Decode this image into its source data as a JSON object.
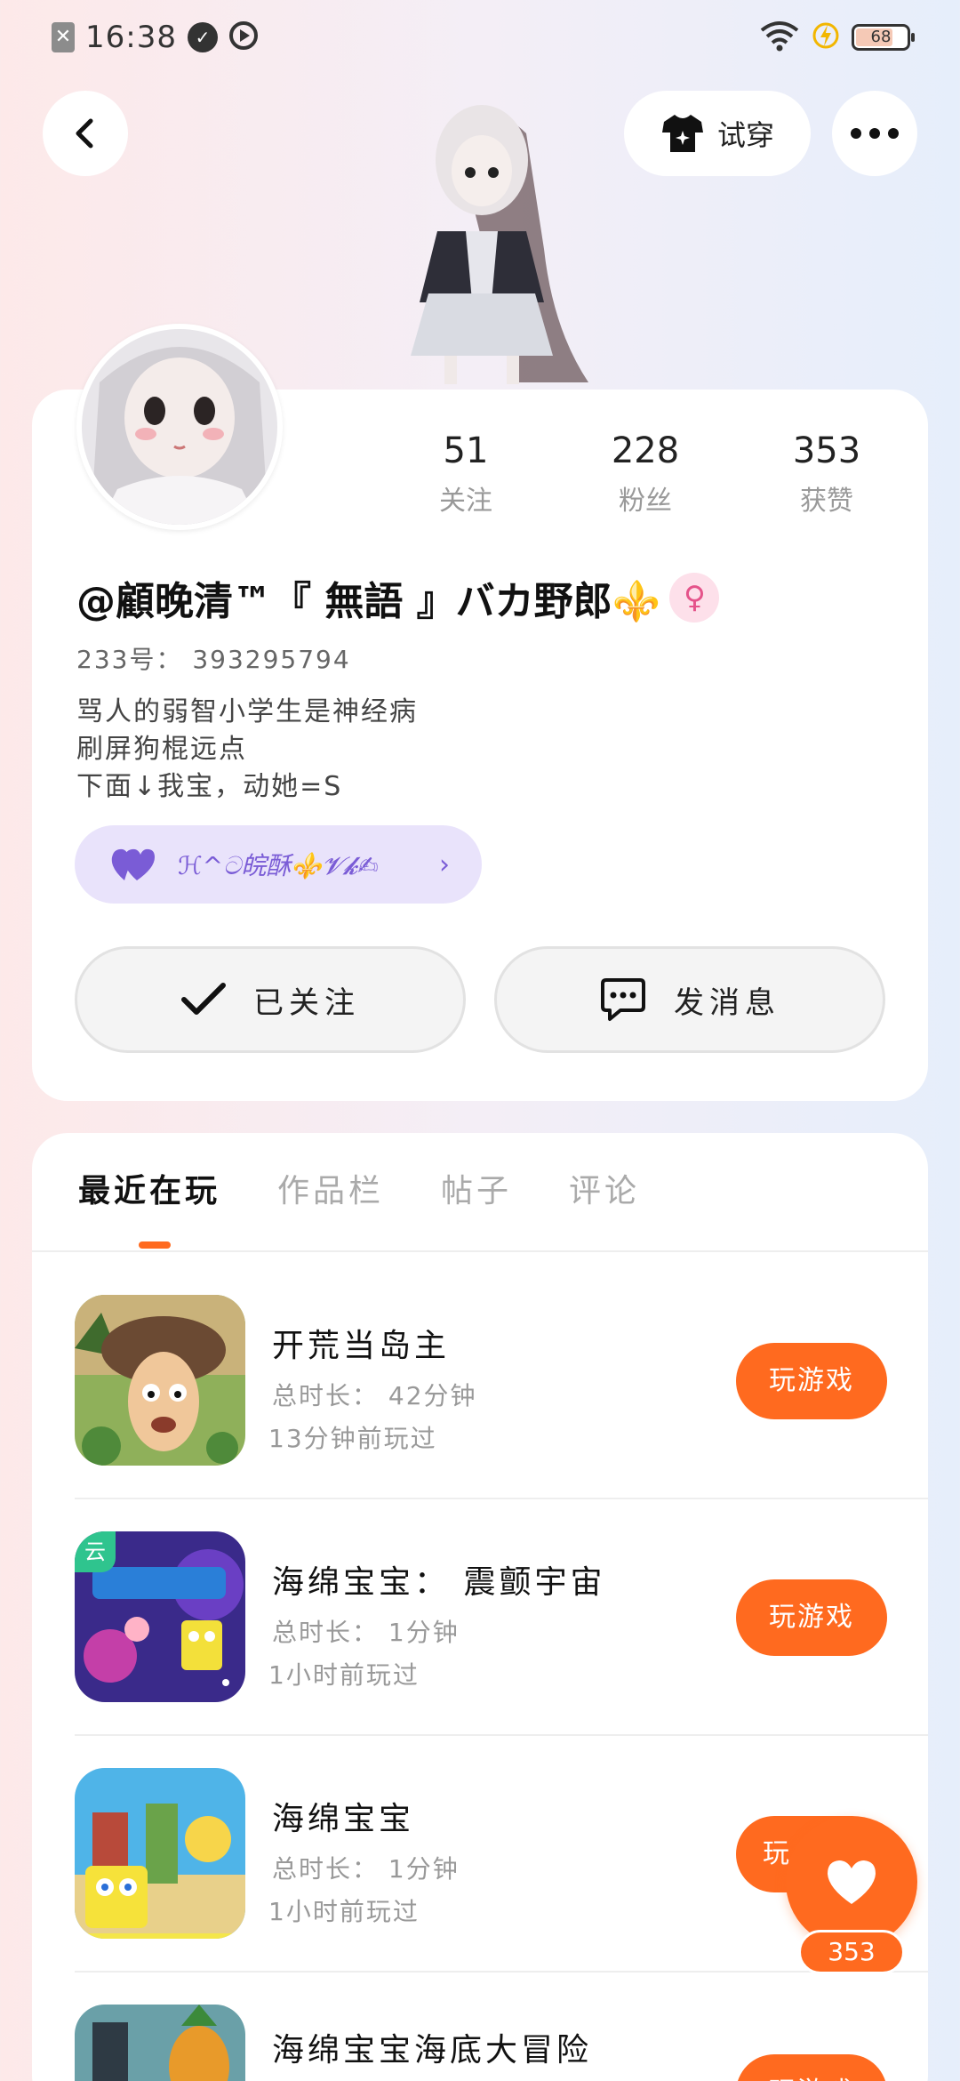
{
  "status_bar": {
    "time": "16:38",
    "battery": "68"
  },
  "header": {
    "try_on_label": "试穿"
  },
  "profile": {
    "stats": [
      {
        "value": "51",
        "label": "关注"
      },
      {
        "value": "228",
        "label": "粉丝"
      },
      {
        "value": "353",
        "label": "获赞"
      }
    ],
    "nickname": "@顧晚清™『 無語 』バカ野郎⚜️",
    "uid": "233号： 393295794",
    "bio": [
      "骂人的弱智小学生是神经病",
      "刷屏狗棍远点",
      "下面↓我宝，动她=S"
    ],
    "fan_badge": "ℋ^ට皖酥⚜️𝓥𝓴✍",
    "follow_label": "已关注",
    "message_label": "发消息"
  },
  "tabs": [
    "最近在玩",
    "作品栏",
    "帖子",
    "评论"
  ],
  "games": [
    {
      "title": "开荒当岛主",
      "duration": "总时长： 42分钟",
      "last_played": "13分钟前玩过",
      "play_label": "玩游戏"
    },
    {
      "title": "海绵宝宝： 震颤宇宙",
      "duration": "总时长： 1分钟",
      "last_played": "1小时前玩过",
      "play_label": "玩游戏",
      "cloud": "云"
    },
    {
      "title": "海绵宝宝",
      "duration": "总时长： 1分钟",
      "last_played": "1小时前玩过",
      "play_label": "玩"
    },
    {
      "title": "海绵宝宝海底大冒险",
      "play_label": "玩游戏"
    }
  ],
  "like_count": "353",
  "colors": {
    "accent": "#ff6a1f",
    "badge_bg": "#e9e3fb",
    "badge_fg": "#7a5cd6"
  }
}
